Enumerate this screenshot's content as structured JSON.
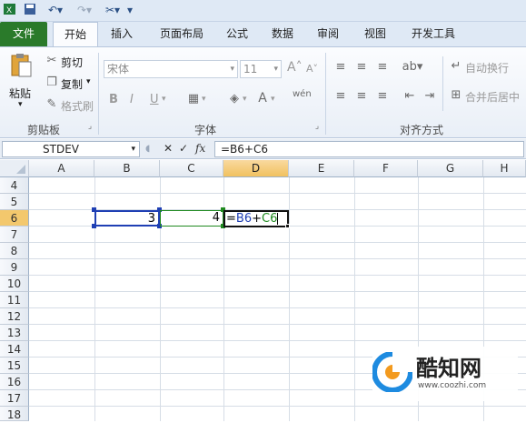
{
  "qat": {
    "save_icon": "save-icon",
    "undo_icon": "undo-icon",
    "redo_icon": "redo-icon",
    "customize_icon": "customize-icon"
  },
  "tabs": [
    {
      "label": "文件"
    },
    {
      "label": "开始"
    },
    {
      "label": "插入"
    },
    {
      "label": "页面布局"
    },
    {
      "label": "公式"
    },
    {
      "label": "数据"
    },
    {
      "label": "审阅"
    },
    {
      "label": "视图"
    },
    {
      "label": "开发工具"
    }
  ],
  "clipboard": {
    "paste": "粘贴",
    "cut": "剪切",
    "copy": "复制",
    "format_painter": "格式刷",
    "group": "剪贴板"
  },
  "font": {
    "name": "宋体",
    "size": "11",
    "bold": "B",
    "italic": "I",
    "underline": "U",
    "grow": "A",
    "shrink": "A",
    "group": "字体"
  },
  "alignment": {
    "wrap": "自动换行",
    "merge": "合并后居中",
    "group": "对齐方式"
  },
  "formula_bar": {
    "name_box": "STDEV",
    "cancel": "✕",
    "enter": "✓",
    "fx": "fx",
    "formula": "=B6+C6"
  },
  "columns": [
    "A",
    "B",
    "C",
    "D",
    "E",
    "F",
    "G",
    "H"
  ],
  "rows": [
    "4",
    "5",
    "6",
    "7",
    "8",
    "9",
    "10",
    "11",
    "12",
    "13",
    "14",
    "15",
    "16",
    "17",
    "18"
  ],
  "cells": {
    "b6": "3",
    "c6": "4",
    "d6_eq": "=",
    "d6_ref1": "B6",
    "d6_plus": "+",
    "d6_ref2": "C6"
  },
  "watermark": {
    "name": "酷知网",
    "url": "www.coozhi.com"
  },
  "colors": {
    "ref1": "#1f3fb4",
    "ref2": "#1f8a1f",
    "file_tab": "#2a7a2a",
    "selected_header": "#f3c86d"
  }
}
